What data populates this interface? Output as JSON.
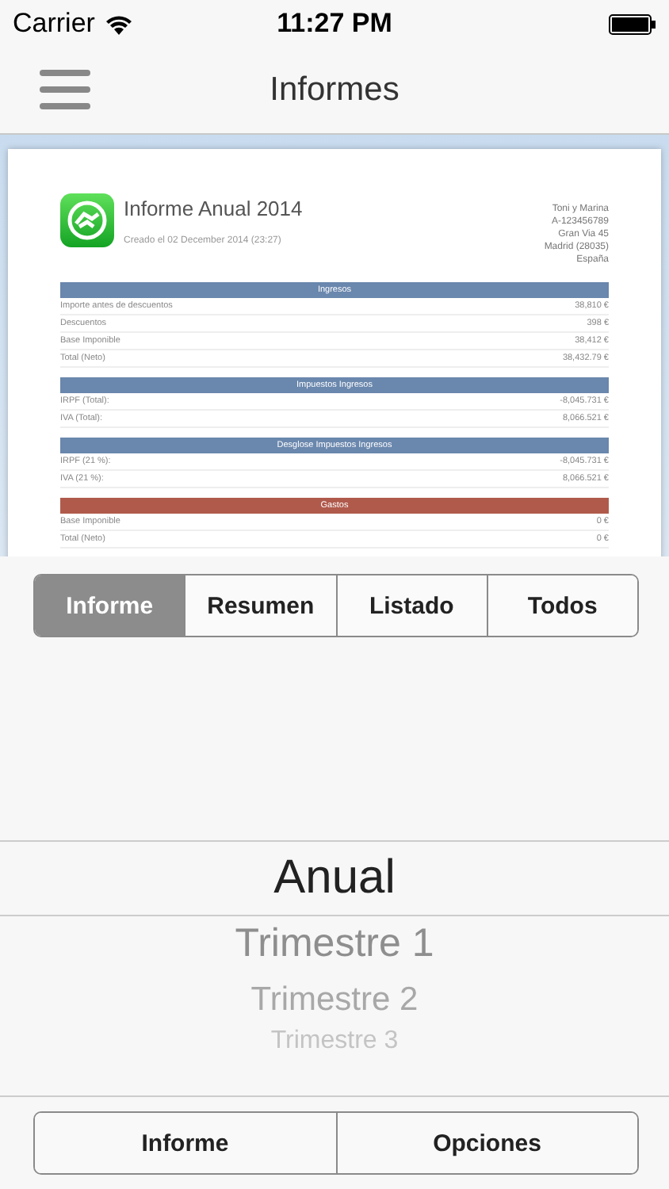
{
  "status_bar": {
    "carrier": "Carrier",
    "time": "11:27 PM"
  },
  "nav": {
    "title": "Informes"
  },
  "report": {
    "title": "Informe Anual 2014",
    "created": "Creado el 02 December 2014 (23:27)",
    "address": [
      "Toni y Marina",
      "A-123456789",
      "Gran Via 45",
      "Madrid (28035)",
      "España"
    ],
    "sections": [
      {
        "title": "Ingresos",
        "color": "#6a87ad",
        "rows": [
          {
            "label": "Importe antes de descuentos",
            "value": "38,810 €"
          },
          {
            "label": "Descuentos",
            "value": "398 €"
          },
          {
            "label": "Base Imponible",
            "value": "38,412 €"
          },
          {
            "label": "Total (Neto)",
            "value": "38,432.79 €"
          }
        ]
      },
      {
        "title": "Impuestos Ingresos",
        "color": "#6a87ad",
        "rows": [
          {
            "label": "IRPF (Total):",
            "value": "-8,045.731 €"
          },
          {
            "label": "IVA (Total):",
            "value": "8,066.521 €"
          }
        ]
      },
      {
        "title": "Desglose Impuestos Ingresos",
        "color": "#6a87ad",
        "rows": [
          {
            "label": "IRPF (21 %):",
            "value": "-8,045.731 €"
          },
          {
            "label": "IVA (21 %):",
            "value": "8,066.521 €"
          }
        ]
      },
      {
        "title": "Gastos",
        "color": "#b05a4c",
        "rows": [
          {
            "label": "Base Imponible",
            "value": "0 €"
          },
          {
            "label": "Total (Neto)",
            "value": "0 €"
          }
        ]
      }
    ]
  },
  "segments": [
    {
      "label": "Informe",
      "selected": true
    },
    {
      "label": "Resumen",
      "selected": false
    },
    {
      "label": "Listado",
      "selected": false
    },
    {
      "label": "Todos",
      "selected": false
    }
  ],
  "picker": [
    {
      "label": "Anual",
      "selected": true
    },
    {
      "label": "Trimestre 1",
      "selected": false
    },
    {
      "label": "Trimestre 2",
      "selected": false
    },
    {
      "label": "Trimestre 3",
      "selected": false
    }
  ],
  "buttons": [
    "Informe",
    "Opciones"
  ]
}
